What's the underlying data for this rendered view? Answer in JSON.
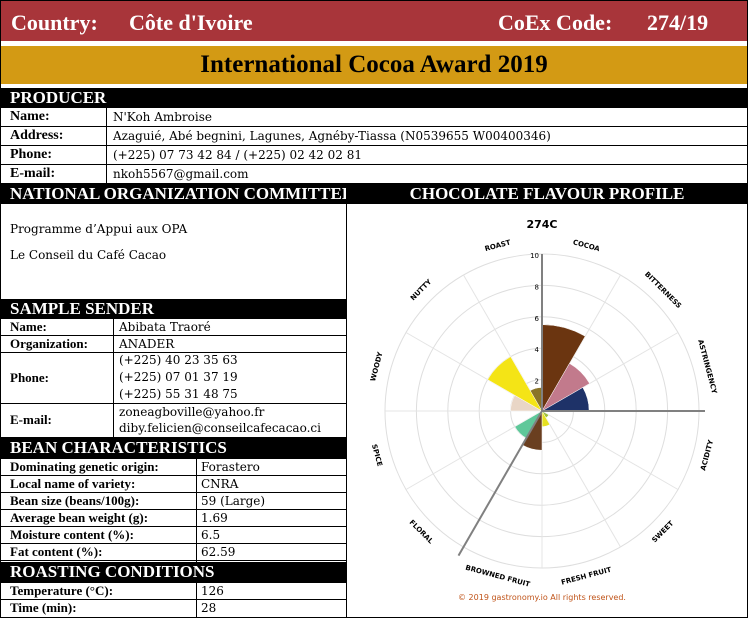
{
  "header": {
    "country_label": "Country:",
    "country_value": "Côte d'Ivoire",
    "code_label": "CoEx Code:",
    "code_value": "274/19",
    "award_title": "International Cocoa Award 2019"
  },
  "producer": {
    "heading": "PRODUCER",
    "rows": [
      {
        "label": "Name:",
        "value": "N'Koh Ambroise"
      },
      {
        "label": "Address:",
        "value": "Azaguié, Abé begnini, Lagunes, Agnéby-Tiassa (N0539655  W00400346)"
      },
      {
        "label": "Phone:",
        "value": "(+225) 07 73 42 84 / (+225) 02 42 02 81"
      },
      {
        "label": "E-mail:",
        "value": "nkoh5567@gmail.com"
      }
    ]
  },
  "noc": {
    "heading": "NATIONAL ORGANIZATION COMMITTEE",
    "lines": [
      "Programme d’Appui aux OPA",
      "Le Conseil du Café Cacao"
    ]
  },
  "sample_sender": {
    "heading": "SAMPLE SENDER",
    "name_label": "Name:",
    "name_value": "Abibata Traoré",
    "org_label": "Organization:",
    "org_value": "ANADER",
    "phone_label": "Phone:",
    "phones": [
      "(+225) 40 23 35 63",
      "(+225) 07 01 37 19",
      "(+225) 55 31 48 75"
    ],
    "email_label": "E-mail:",
    "emails": [
      "zoneagboville@yahoo.fr",
      "diby.felicien@conseilcafecacao.ci"
    ]
  },
  "bean": {
    "heading": "BEAN CHARACTERISTICS",
    "rows": [
      {
        "label": "Dominating genetic origin:",
        "value": "Forastero"
      },
      {
        "label": "Local name of variety:",
        "value": "CNRA"
      },
      {
        "label": "Bean size (beans/100g):",
        "value": "59 (Large)"
      },
      {
        "label": "Average bean weight (g):",
        "value": "1.69"
      },
      {
        "label": "Moisture content (%):",
        "value": "6.5"
      },
      {
        "label": "Fat content (%):",
        "value": "62.59"
      }
    ]
  },
  "roasting": {
    "heading": "ROASTING CONDITIONS",
    "rows": [
      {
        "label": "Temperature (°C):",
        "value": "126"
      },
      {
        "label": "Time (min):",
        "value": "28"
      }
    ]
  },
  "flavour": {
    "heading": "CHOCOLATE FLAVOUR PROFILE",
    "copyright": "© 2019 gastronomy.io All rights reserved."
  },
  "chart_data": {
    "type": "radar",
    "title": "274C",
    "r_ticks": [
      "2",
      "4",
      "6",
      "8",
      "10"
    ],
    "rlim": [
      0,
      10
    ],
    "categories": [
      "COCOA",
      "BITTERNESS",
      "ASTRINGENCY",
      "ACIDITY",
      "SWEET",
      "FRESH FRUIT",
      "BROWNED FRUIT",
      "FLORAL",
      "SPICE",
      "WOODY",
      "NUTTY",
      "ROAST"
    ],
    "values": [
      5.5,
      3.5,
      3.0,
      0,
      0.5,
      1.0,
      2.5,
      2.0,
      0,
      2.0,
      4.0,
      1.5
    ],
    "colors": [
      "#6b3510",
      "#c27a8c",
      "#1e3268",
      "#6e8ea0",
      "#9fbf3a",
      "#e6e020",
      "#6a3f20",
      "#5fc89a",
      "#a56a52",
      "#e9d6c6",
      "#f4e416",
      "#8a7428"
    ]
  }
}
